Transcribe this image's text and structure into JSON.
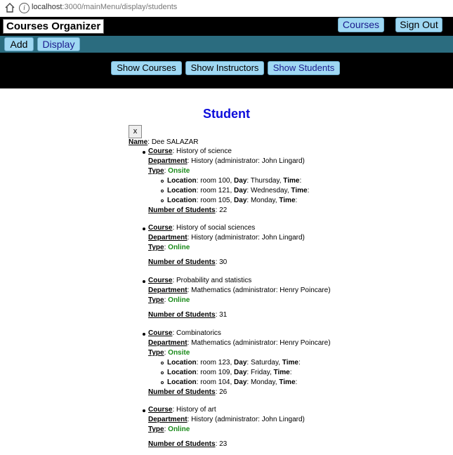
{
  "address": {
    "host": "localhost",
    "path": ":3000/mainMenu/display/students"
  },
  "header": {
    "brand": "Courses Organizer",
    "courses_label": "Courses",
    "signout_label": "Sign Out"
  },
  "subnav": {
    "add_label": "Add",
    "display_label": "Display"
  },
  "tabs": {
    "courses": "Show Courses",
    "instructors": "Show Instructors",
    "students": "Show Students"
  },
  "page": {
    "title": "Student",
    "close_label": "x"
  },
  "student": {
    "name_label": "Name",
    "name": "Dee SALAZAR",
    "courses": [
      {
        "course": "History of science",
        "department": "History (administrator: John Lingard)",
        "type": "Onsite",
        "locations": [
          {
            "room": "room 100",
            "day": "Thursday"
          },
          {
            "room": "room 121",
            "day": "Wednesday"
          },
          {
            "room": "room 105",
            "day": "Monday"
          }
        ],
        "students": "22"
      },
      {
        "course": "History of social sciences",
        "department": "History (administrator: John Lingard)",
        "type": "Online",
        "locations": [],
        "students": "30"
      },
      {
        "course": "Probability and statistics",
        "department": "Mathematics (administrator: Henry Poincare)",
        "type": "Online",
        "locations": [],
        "students": "31"
      },
      {
        "course": "Combinatorics",
        "department": "Mathematics (administrator: Henry Poincare)",
        "type": "Onsite",
        "locations": [
          {
            "room": "room 123",
            "day": "Saturday"
          },
          {
            "room": "room 109",
            "day": "Friday"
          },
          {
            "room": "room 104",
            "day": "Monday"
          }
        ],
        "students": "26"
      },
      {
        "course": "History of art",
        "department": "History (administrator: John Lingard)",
        "type": "Online",
        "locations": [],
        "students": "23"
      }
    ]
  },
  "labels": {
    "course": "Course",
    "department": "Department",
    "type": "Type",
    "location": "Location",
    "day": "Day",
    "time": "Time",
    "students": "Number of Students"
  }
}
